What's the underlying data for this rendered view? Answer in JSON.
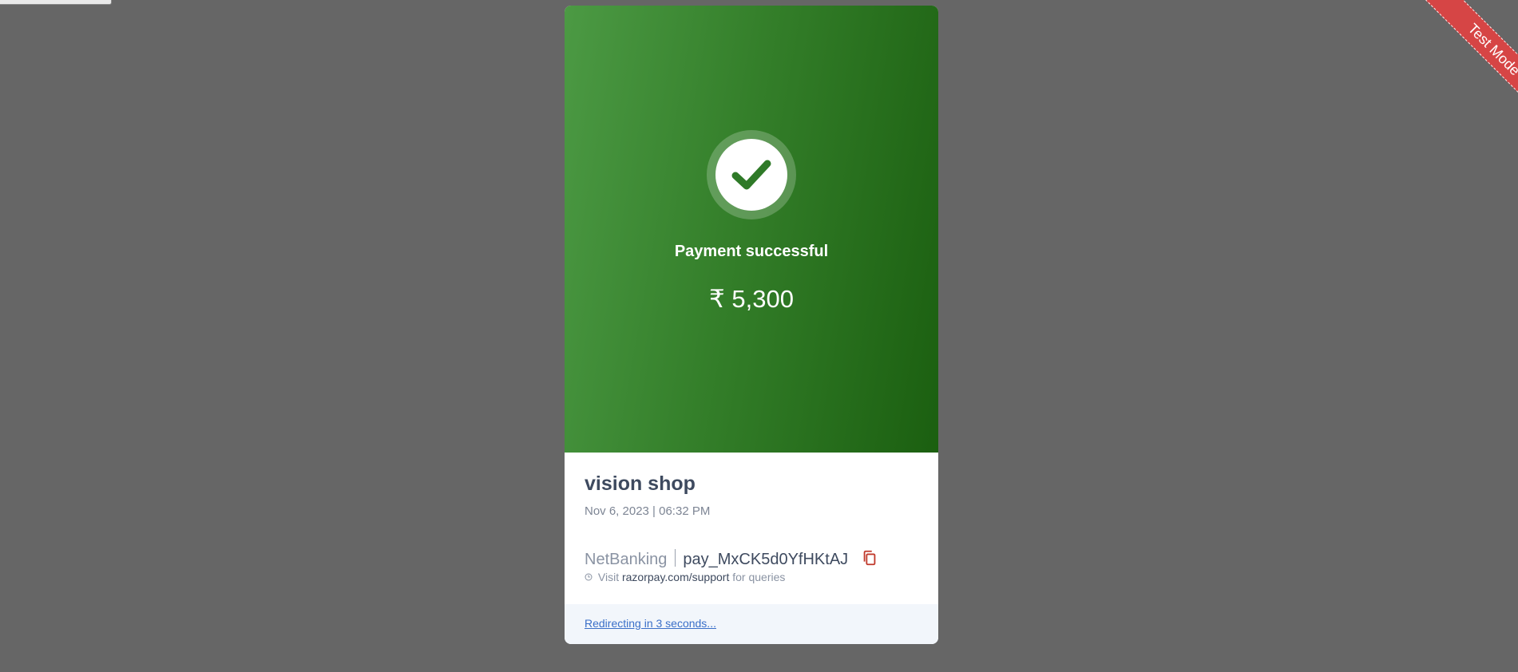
{
  "ribbon": {
    "label": "Test Mode",
    "color": "#d64545"
  },
  "payment": {
    "status_icon": "check-circle-icon",
    "status_text": "Payment successful",
    "amount": "₹ 5,300",
    "accent_color": "#347f2a"
  },
  "merchant": {
    "name": "vision shop",
    "datetime": "Nov 6, 2023 | 06:32 PM"
  },
  "transaction": {
    "method": "NetBanking",
    "payment_id": "pay_MxCK5d0YfHKtAJ",
    "copy_icon": "copy-icon"
  },
  "support": {
    "prefix": "Visit",
    "link": "razorpay.com/support",
    "suffix": "for queries",
    "icon": "clock-icon"
  },
  "footer": {
    "redirect_text": "Redirecting in 3 seconds..."
  }
}
